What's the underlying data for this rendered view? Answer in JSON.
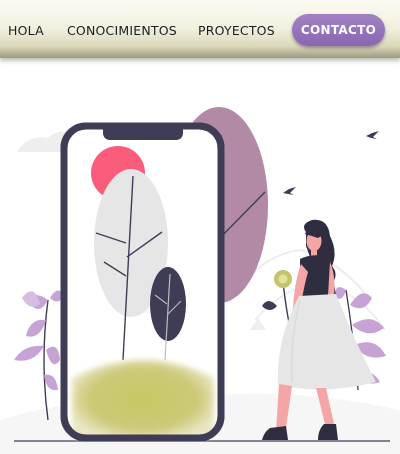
{
  "nav": {
    "items": [
      {
        "label": "HOLA"
      },
      {
        "label": "CONOCIMIENTOS"
      },
      {
        "label": "PROYECTOS"
      }
    ],
    "cta": {
      "label": "CONTACTO"
    }
  },
  "colors": {
    "header_gradient": [
      "#fbfbf2",
      "#dad7ba",
      "#9d9a80"
    ],
    "accent_purple": "#8a66b3",
    "nav_text": "#1c1c25",
    "phone_frame": "#3f3d56",
    "mauve_tree": "#b28aa6",
    "lilac_leaf": "#c6a3d4",
    "sun_pink": "#fa5c7c",
    "ground_olive": "#c6c46a",
    "dress_gray": "#e6e6e6"
  },
  "hero": {
    "illustration": "woman-with-phone-and-trees-illustration"
  }
}
